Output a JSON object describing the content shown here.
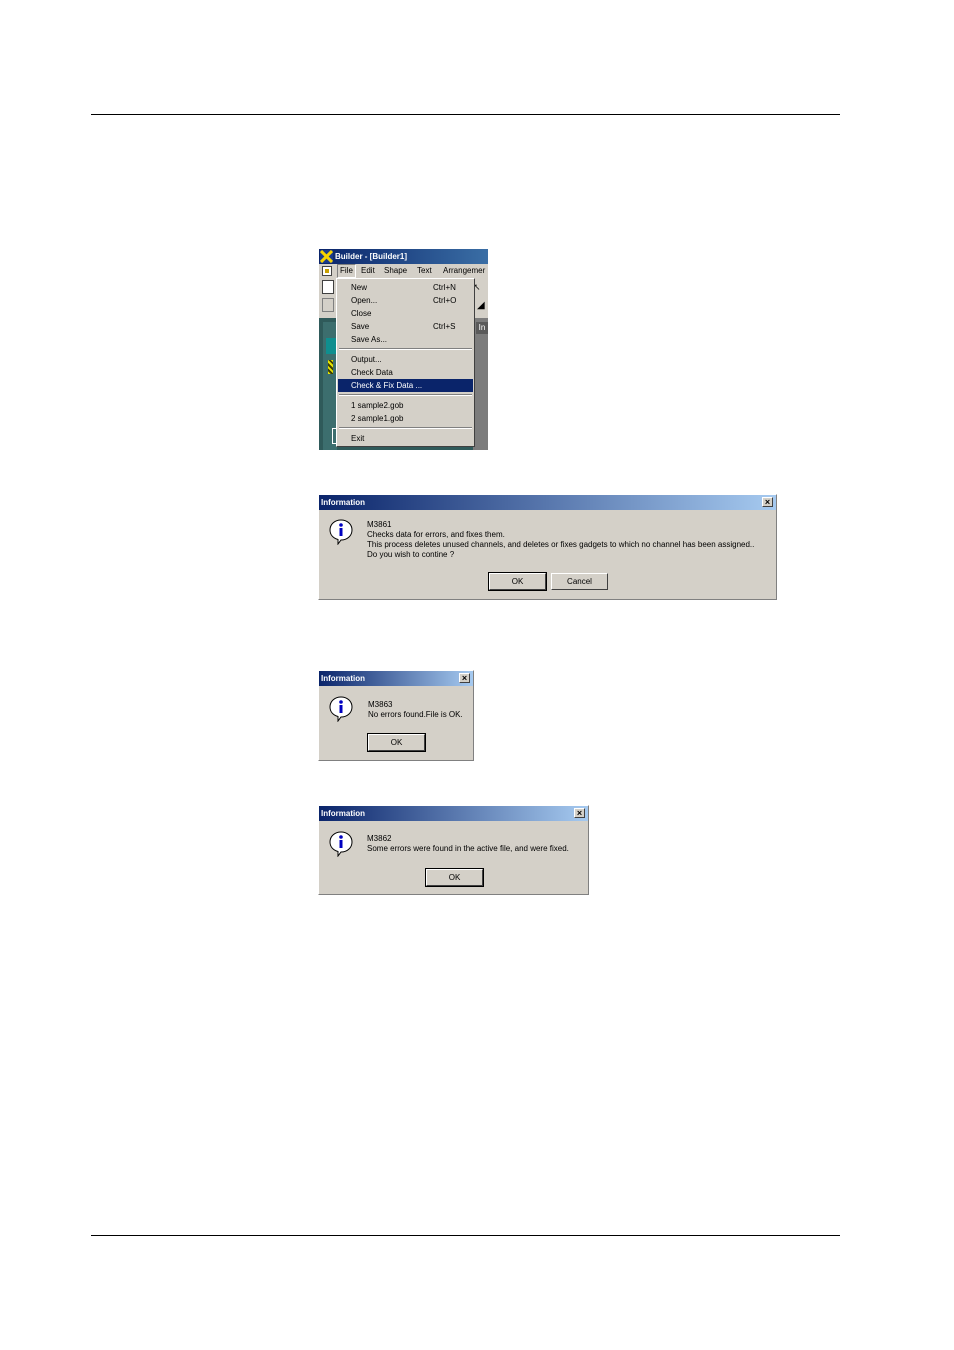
{
  "builder": {
    "title": "Builder - [Builder1]",
    "menubar": [
      "File",
      "Edit",
      "Shape",
      "Text",
      "Arrangemer"
    ],
    "workspace_tab": "In",
    "file_menu": {
      "items": [
        {
          "label": "New",
          "shortcut": "Ctrl+N"
        },
        {
          "label": "Open...",
          "shortcut": "Ctrl+O"
        },
        {
          "label": "Close",
          "shortcut": ""
        },
        {
          "label": "Save",
          "shortcut": "Ctrl+S"
        },
        {
          "label": "Save As...",
          "shortcut": ""
        },
        {
          "label": "Output...",
          "shortcut": ""
        },
        {
          "label": "Check Data",
          "shortcut": ""
        },
        {
          "label": "Check & Fix Data ...",
          "shortcut": "",
          "selected": true
        },
        {
          "label": "1 sample2.gob",
          "shortcut": ""
        },
        {
          "label": "2 sample1.gob",
          "shortcut": ""
        },
        {
          "label": "Exit",
          "shortcut": ""
        }
      ]
    }
  },
  "dialogs": [
    {
      "title": "Information",
      "lines": [
        "M3861",
        "Checks data for errors, and fixes them.",
        "This process deletes unused channels, and deletes or fixes gadgets to which no channel has been assigned..",
        "Do you wish to contine ?"
      ],
      "buttons": [
        "OK",
        "Cancel"
      ]
    },
    {
      "title": "Information",
      "lines": [
        "M3863",
        "No errors found.File is OK."
      ],
      "buttons": [
        "OK"
      ]
    },
    {
      "title": "Information",
      "lines": [
        "M3862",
        "Some errors were found in the active file, and were fixed."
      ],
      "buttons": [
        "OK"
      ]
    }
  ]
}
